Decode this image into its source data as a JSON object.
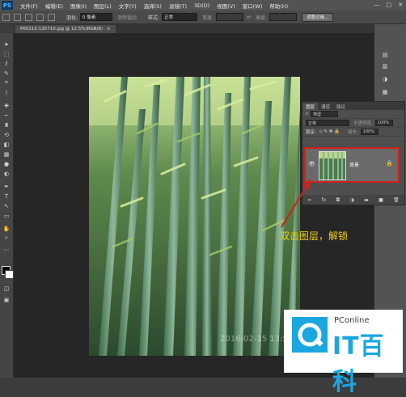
{
  "app": {
    "logo_text": "PS"
  },
  "menu": [
    "文件(F)",
    "编辑(E)",
    "图像(I)",
    "图层(L)",
    "文字(Y)",
    "选择(S)",
    "滤镜(T)",
    "3D(D)",
    "视图(V)",
    "窗口(W)",
    "帮助(H)"
  ],
  "window_controls": {
    "minimize": "—",
    "maximize": "□",
    "close": "✕"
  },
  "options_bar": {
    "feather_label": "羽化:",
    "feather_value": "0 像素",
    "antialias_label": "消除锯齿",
    "style_label": "样式:",
    "style_value": "正常",
    "width_label": "宽度:",
    "height_label": "高度:",
    "refine_button": "调整边缘..."
  },
  "document": {
    "tab_title": "P60215-135710.jpg @ 12.5%(RGB/8)",
    "close": "×"
  },
  "layers_panel": {
    "tabs": [
      "图层",
      "通道",
      "路径"
    ],
    "kind_label": "类型",
    "blend_mode": "正常",
    "opacity_label": "不透明度:",
    "opacity_value": "100%",
    "lock_label": "锁定:",
    "fill_label": "填充:",
    "fill_value": "100%",
    "layer_name": "背景",
    "footer_icons": [
      "∞",
      "fx",
      "◘",
      "◑",
      "▬",
      "■",
      "🗑"
    ]
  },
  "annotation": {
    "text": "双击图层，解锁"
  },
  "photo": {
    "timestamp": "2016-02-15 13:57"
  },
  "logo": {
    "brand": "PConline",
    "big_text": "IT百科"
  },
  "colors": {
    "annotation": "#f0d21a",
    "highlight_border": "#d2201a",
    "brand_blue": "#1aa7e0"
  }
}
